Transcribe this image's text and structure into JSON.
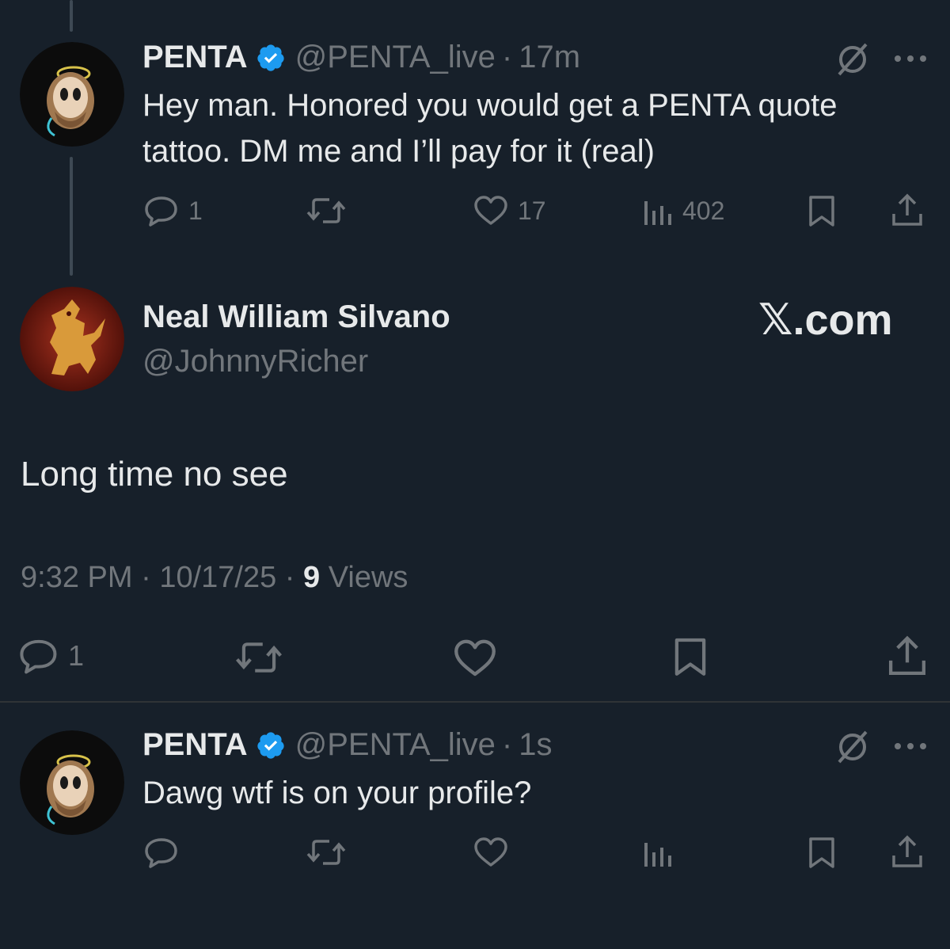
{
  "tweet1": {
    "name": "PENTA",
    "handle": "@PENTA_live",
    "sep": "·",
    "time": "17m",
    "text_line1": "Hey man. Honored you would get a PENTA quote",
    "text_line2": "tattoo. DM me and I’ll pay for it (real)",
    "replies": "1",
    "likes": "17",
    "views": "402"
  },
  "main_tweet": {
    "name": "Neal William Silvano",
    "handle": "@JohnnyRicher",
    "watermark": "𝕏.com",
    "text": "Long time no see",
    "time": "9:32 PM",
    "sep1": "·",
    "date": "10/17/25",
    "sep2": "·",
    "views_count": "9",
    "views_label": "Views",
    "replies": "1"
  },
  "tweet3": {
    "name": "PENTA",
    "handle": "@PENTA_live",
    "sep": "·",
    "time": "1s",
    "text": "Dawg wtf is on your profile?"
  },
  "colors": {
    "background": "#17202a",
    "muted": "#71767b",
    "verified": "#1d9bf0",
    "text": "#e7e9ea"
  }
}
